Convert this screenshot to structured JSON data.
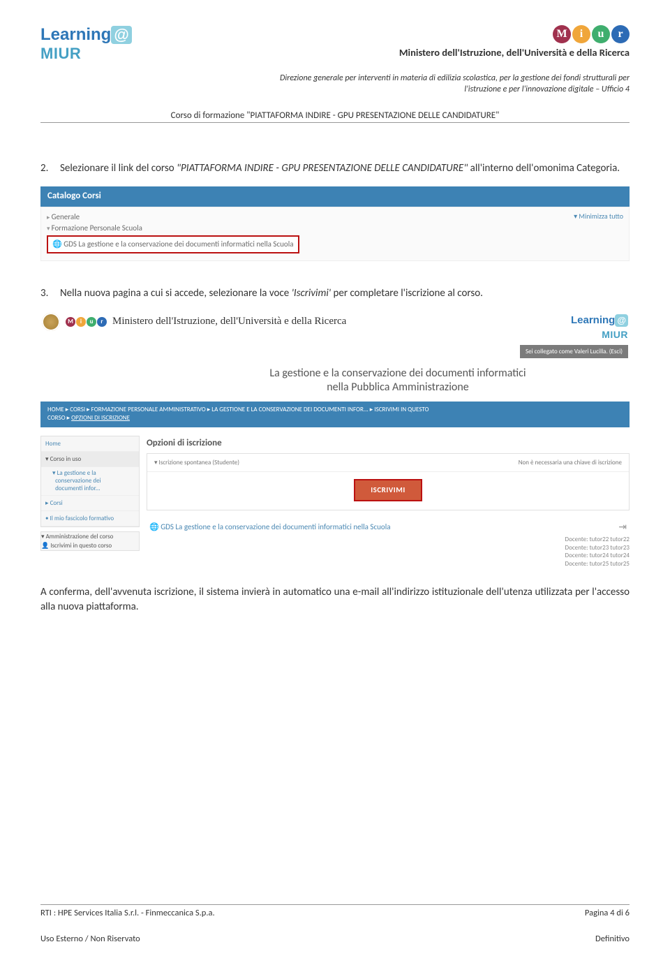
{
  "header": {
    "logo_word1": "Learning",
    "logo_at": "@",
    "logo_word2": "MIUR",
    "miur_letters": [
      "M",
      "i",
      "u",
      "r"
    ],
    "ministero": "Ministero dell'Istruzione, dell'Università e della Ricerca",
    "direzione_l1": "Direzione generale per interventi in materia di edilizia scolastica, per la gestione dei fondi strutturali per",
    "direzione_l2": "l'istruzione e per l'innovazione digitale – Ufficio 4",
    "corso": "Corso di formazione \"PIATTAFORMA INDIRE - GPU PRESENTAZIONE DELLE CANDIDATURE\""
  },
  "body": {
    "item2_num": "2.",
    "item2_pre": "Selezionare il link del corso ",
    "item2_title": "\"PIATTAFORMA INDIRE - GPU PRESENTAZIONE DELLE CANDIDATURE\"",
    "item2_post": " all'interno dell'omonima Categoria.",
    "item3_num": "3.",
    "item3_pre": "Nella nuova pagina a cui si accede, selezionare la voce ",
    "item3_em": "'Iscrivimi'",
    "item3_post": " per completare l'iscrizione al corso.",
    "conferma": "A conferma, dell'avvenuta iscrizione, il sistema invierà in automatico una e-mail all'indirizzo istituzionale dell'utenza utilizzata per l'accesso alla nuova piattaforma."
  },
  "shot1": {
    "header": "Catalogo Corsi",
    "minimizza": "▾ Minimizza tutto",
    "generale": "Generale",
    "formazione": "Formazione Personale Scuola",
    "course": "GDS La gestione e la conservazione dei documenti informatici nella Scuola"
  },
  "shot2": {
    "ministero_script": "Ministero dell'Istruzione, dell'Università e della Ricerca",
    "title_l1": "La gestione e la conservazione dei documenti informatici",
    "title_l2": "nella Pubblica Amministrazione",
    "login_status": "Sei collegato come Valeri Lucilla. (Esci)",
    "breadcrumb_l1": "HOME ▸ CORSI ▸ FORMAZIONE PERSONALE AMMINISTRATIVO ▸ LA GESTIONE E LA CONSERVAZIONE DEI DOCUMENTI INFOR... ▸ ISCRIVIMI IN QUESTO",
    "breadcrumb_l2": "CORSO ▸ ",
    "breadcrumb_opz": "OPZIONI DI ISCRIZIONE",
    "side": {
      "home": "Home",
      "corso_in_uso": "Corso in uso",
      "sub1_l1": "La gestione e la",
      "sub1_l2": "conservazione dei",
      "sub1_l3": "documenti infor...",
      "corsi": "Corsi",
      "fascicolo": "Il mio fascicolo formativo",
      "amm": "Amministrazione del corso",
      "iscrivimi": "Iscrivimi in questo corso"
    },
    "opzioni_title": "Opzioni di iscrizione",
    "row1_left": "▾ Iscrizione spontanea (Studente)",
    "row1_right": "Non è necessaria una chiave di iscrizione",
    "iscrivimi_btn": "ISCRIVIMI",
    "gds": "GDS La gestione e la conservazione dei documenti informatici nella Scuola",
    "docenti": [
      "Docente: tutor22 tutor22",
      "Docente: tutor23 tutor23",
      "Docente: tutor24 tutor24",
      "Docente: tutor25 tutor25"
    ]
  },
  "footer": {
    "rti": "RTI : HPE Services Italia S.r.l. - Finmeccanica S.p.a.",
    "page": "Pagina 4 di 6",
    "uso": "Uso Esterno  /  Non Riservato",
    "def": "Definitivo"
  }
}
